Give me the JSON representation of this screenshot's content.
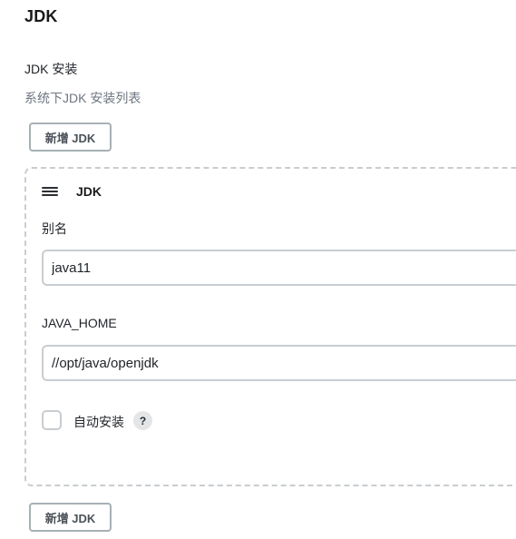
{
  "section": {
    "title": "JDK"
  },
  "jdk_installations": {
    "label": "JDK 安装",
    "description": "系统下JDK 安装列表",
    "add_button_label": "新增 JDK"
  },
  "jdk_entry": {
    "title": "JDK",
    "alias_label": "别名",
    "alias_value": "java11",
    "java_home_label": "JAVA_HOME",
    "java_home_value": "//opt/java/openjdk",
    "auto_install_label": "自动安装",
    "auto_install_checked": false,
    "help_label": "?"
  },
  "icons": {
    "drag_handle": "menu-drag-icon",
    "help": "question-mark-icon"
  }
}
